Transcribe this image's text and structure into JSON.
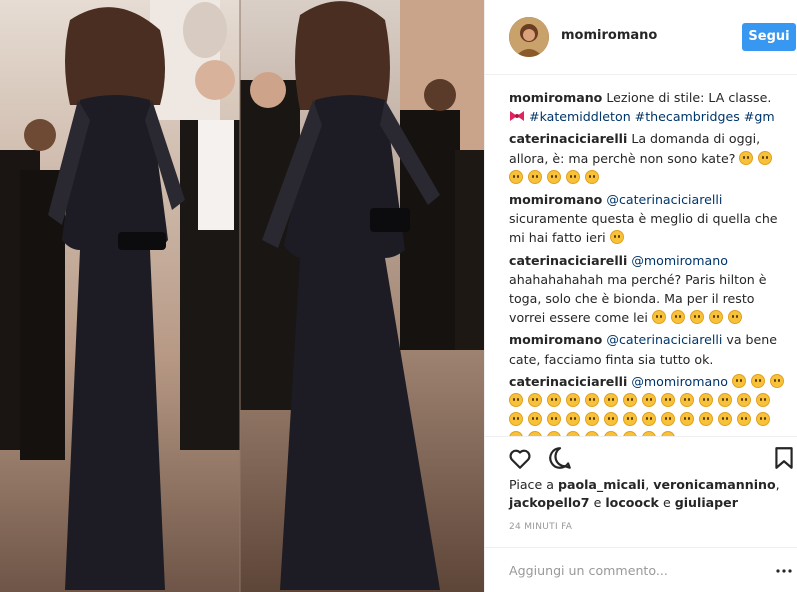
{
  "header": {
    "username": "momiromano",
    "follow_label": "Segui"
  },
  "caption": {
    "user": "momiromano",
    "text": "Lezione di stile: LA classe. ",
    "hashtags": "#katemiddleton #thecambridges #gm"
  },
  "comments": [
    {
      "user": "caterinaciciarelli",
      "text": "La domanda di oggi, allora, è: ma perchè non sono kate?",
      "emoji_count": 7
    },
    {
      "user": "momiromano",
      "mention": "@caterinaciciarelli",
      "text": " sicuramente questa è meglio di quella che mi hai fatto ieri",
      "emoji_count": 1
    },
    {
      "user": "caterinaciciarelli",
      "mention": "@momiromano",
      "text": " ahahahahahah ma perché? Paris hilton è toga, solo che è bionda. Ma per il resto vorrei essere come lei",
      "emoji_count": 5
    },
    {
      "user": "momiromano",
      "mention": "@caterinaciciarelli",
      "text": " va bene cate, facciamo finta sia tutto ok.",
      "emoji_count": 0
    },
    {
      "user": "caterinaciciarelli",
      "mention": "@momiromano",
      "text": " ",
      "emoji_count": 40
    }
  ],
  "likes": {
    "prefix": "Piace a ",
    "user1": "paola_micali",
    "sep1": ", ",
    "user2": "veronicamannino",
    "sep2": ", ",
    "user3": "jackopello7",
    "sep3": " e ",
    "user4": "locoock",
    "sep4": " e ",
    "user5": "giuliaper"
  },
  "timestamp": "24 minuti fa",
  "add_comment": {
    "placeholder": "Aggiungi un commento..."
  },
  "icons": {
    "like": "heart-icon",
    "comment": "speech-bubble-icon",
    "save": "bookmark-icon",
    "more": "more-dots-icon",
    "caption_emoji": "ribbon-bow-icon",
    "reaction_emoji": "crying-face-icon"
  },
  "colors": {
    "follow_button": "#3897f0",
    "hashtag": "#003569",
    "ribbon": "#e0245e",
    "emoji": "#f7c23a"
  }
}
